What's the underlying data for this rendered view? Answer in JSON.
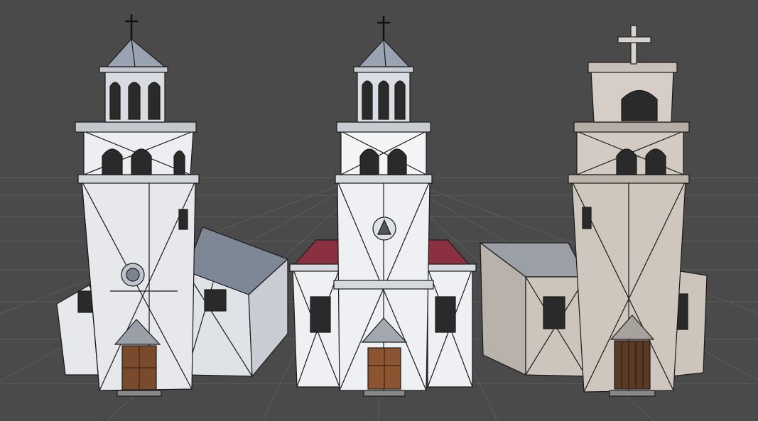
{
  "scene": {
    "background_color": "#4a4a4a",
    "grid_color": "#5a5a5a",
    "wire_color": "#1a1a1a",
    "churches": [
      {
        "id": "church-left",
        "wall_color": "#e6e8ec",
        "roof_color": "#7d8796",
        "door_color": "#7a4a2c",
        "has_clock": false,
        "has_rose_window": true,
        "cross_style": "small"
      },
      {
        "id": "church-middle",
        "wall_color": "#eef0f3",
        "roof_color": "#8a3040",
        "door_color": "#8a5530",
        "has_clock": true,
        "has_rose_window": false,
        "cross_style": "small"
      },
      {
        "id": "church-right",
        "wall_color": "#cdc4bc",
        "roof_color": "#9aa0a6",
        "door_color": "#5a3a24",
        "has_clock": false,
        "has_rose_window": false,
        "cross_style": "large"
      }
    ]
  }
}
